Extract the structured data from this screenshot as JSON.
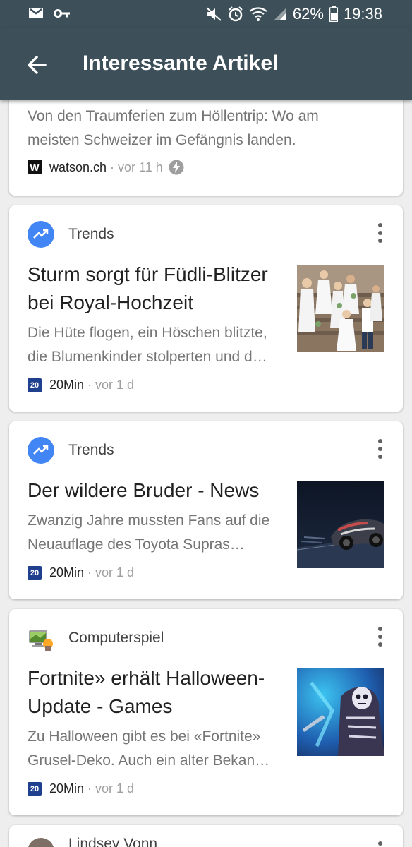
{
  "status_bar": {
    "battery": "62%",
    "time": "19:38"
  },
  "app_bar": {
    "title": "Interessante Artikel"
  },
  "cards": [
    {
      "snippet": "Von den Traumferien zum Höllentrip: Wo am meisten Schweizer im Gefängnis landen.",
      "source": "watson.ch",
      "time": "vor 11 h"
    },
    {
      "topic": "Trends",
      "headline": "Sturm sorgt für Füdli-Blitzer bei Royal-Hochzeit",
      "snippet": "Die Hüte flogen, ein Höschen blitzte, die Blumenkinder stolperten und d…",
      "source": "20Min",
      "time": "vor 1 d"
    },
    {
      "topic": "Trends",
      "headline": "Der wildere Bruder - News",
      "snippet": "Zwanzig Jahre mussten Fans auf die Neuauflage des Toyota Supras…",
      "source": "20Min",
      "time": "vor 1 d"
    },
    {
      "topic": "Computerspiel",
      "headline": "Fortnite» erhält Halloween-Update - Games",
      "snippet": "Zu Halloween gibt es bei «Fortnite» Grusel-Deko. Auch ein alter Bekan…",
      "source": "20Min",
      "time": "vor 1 d"
    },
    {
      "topic": "Lindsey Vonn"
    }
  ],
  "colors": {
    "app_bar": "#3d5059",
    "trend_icon": "#4285f4",
    "background": "#eeeeee"
  }
}
